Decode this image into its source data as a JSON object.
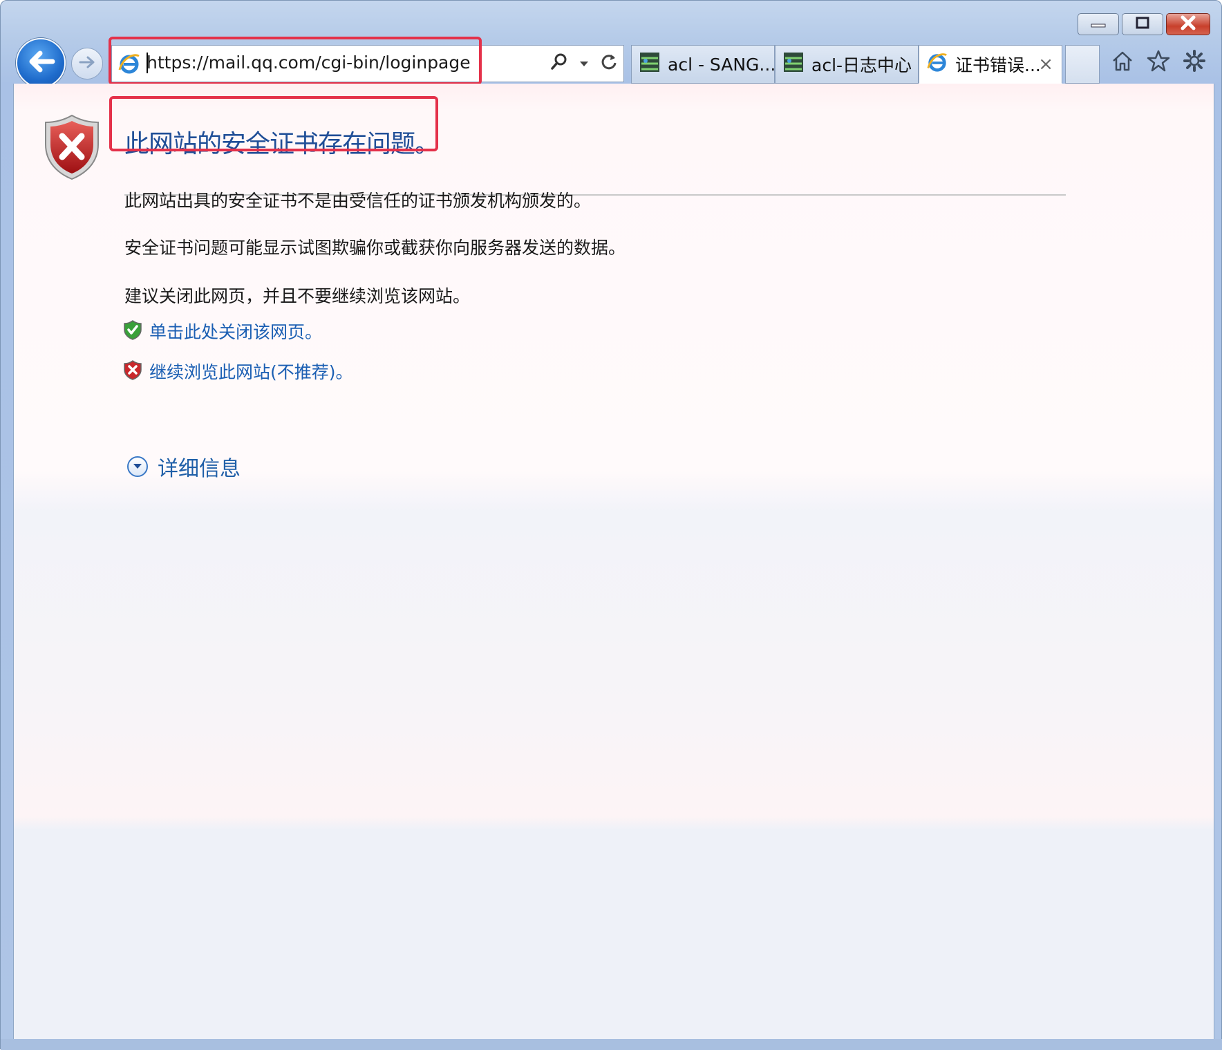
{
  "window": {
    "address_url": "https://mail.qq.com/cgi-bin/loginpage",
    "caption_buttons": [
      "minimize-icon",
      "restore-icon",
      "close-icon"
    ]
  },
  "tabs": [
    {
      "label": "acl - SANG...",
      "icon": "network-icon",
      "active": false
    },
    {
      "label": "acl-日志中心",
      "icon": "network-icon",
      "active": false
    },
    {
      "label": "证书错误...",
      "icon": "ie-icon",
      "active": true,
      "close": "×"
    }
  ],
  "toolbar_icons": [
    "home-icon",
    "star-icon",
    "gear-icon"
  ],
  "page": {
    "title": "此网站的安全证书存在问题。",
    "p1": "此网站出具的安全证书不是由受信任的证书颁发机构颁发的。",
    "p2": "安全证书问题可能显示试图欺骗你或截获你向服务器发送的数据。",
    "p3": "建议关闭此网页，并且不要继续浏览该网站。",
    "link_close": "单击此处关闭该网页。",
    "link_continue": "继续浏览此网站(不推荐)。",
    "details": "详细信息"
  },
  "colors": {
    "highlight_box": "#e4314a",
    "title": "#1f4e97",
    "link": "#1b5fb3"
  }
}
